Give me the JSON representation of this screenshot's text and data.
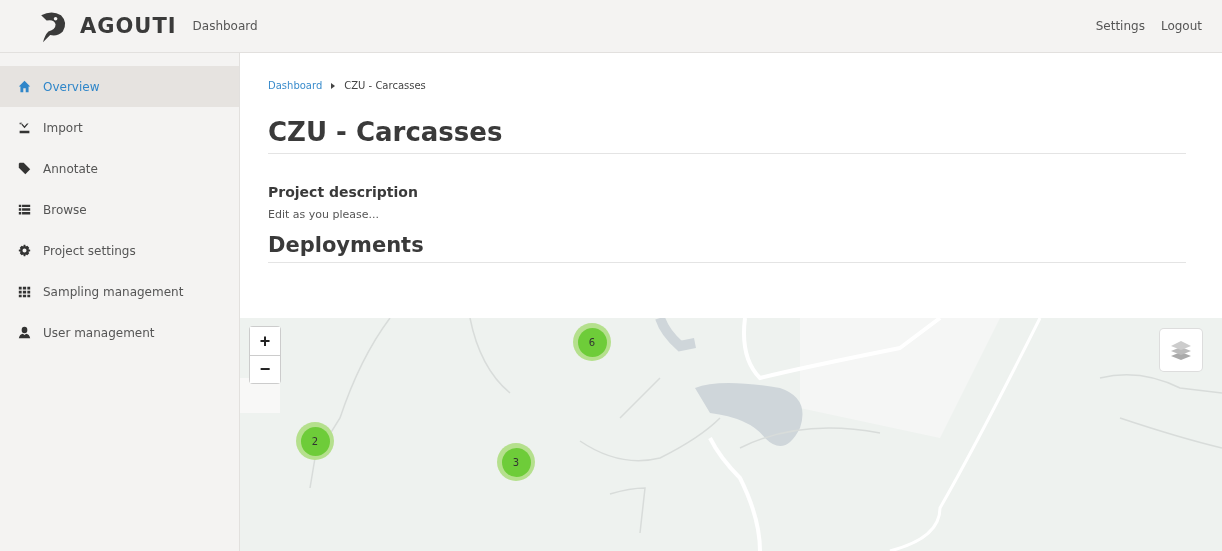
{
  "header": {
    "brand": "AGOUTI",
    "nav_link": "Dashboard",
    "links": [
      "Settings",
      "Logout"
    ]
  },
  "sidebar": {
    "items": [
      {
        "label": "Overview",
        "selected": true
      },
      {
        "label": "Import",
        "selected": false
      },
      {
        "label": "Annotate",
        "selected": false
      },
      {
        "label": "Browse",
        "selected": false
      },
      {
        "label": "Project settings",
        "selected": false
      },
      {
        "label": "Sampling management",
        "selected": false
      },
      {
        "label": "User management",
        "selected": false
      }
    ]
  },
  "breadcrumb": {
    "link": "Dashboard",
    "current": "CZU - Carcasses"
  },
  "title": "CZU - Carcasses",
  "description": {
    "heading": "Project description",
    "text": "Edit as you please..."
  },
  "deployments": {
    "heading": "Deployments",
    "map": {
      "kind": "picture",
      "zoom_in": "+",
      "zoom_out": "−",
      "clusters": [
        {
          "count": "6"
        },
        {
          "count": "2"
        },
        {
          "count": "3"
        }
      ]
    }
  }
}
